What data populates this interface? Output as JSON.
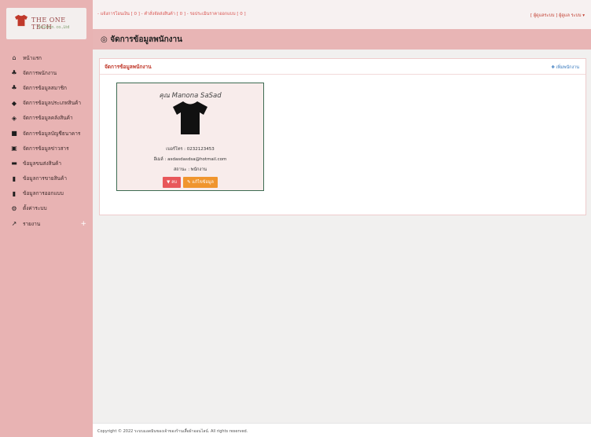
{
  "brand": {
    "title": "THE ONE TECH",
    "subtitle": "Solution. co.,Ltd"
  },
  "sidebar": {
    "items": [
      {
        "label": "หน้าแรก",
        "icon": "home-icon",
        "glyph": "⌂"
      },
      {
        "label": "จัดการพนักงาน",
        "icon": "users-icon",
        "glyph": "♣"
      },
      {
        "label": "จัดการข้อมูลสมาชิก",
        "icon": "members-icon",
        "glyph": "♣"
      },
      {
        "label": "จัดการข้อมูลประเภทสินค้า",
        "icon": "cube-icon",
        "glyph": "◆"
      },
      {
        "label": "จัดการข้อมูลคลังสินค้า",
        "icon": "cubes-icon",
        "glyph": "◈"
      },
      {
        "label": "จัดการข้อมูลบัญชีธนาคาร",
        "icon": "book-icon",
        "glyph": "■"
      },
      {
        "label": "จัดการข้อมูลข่าวสาร",
        "icon": "newspaper-icon",
        "glyph": "▣"
      },
      {
        "label": "ข้อมูลขนส่งสินค้า",
        "icon": "truck-icon",
        "glyph": "▬"
      },
      {
        "label": "ข้อมูลการขายสินค้า",
        "icon": "file-icon",
        "glyph": "▮"
      },
      {
        "label": "ข้อมูลการออกแบบ",
        "icon": "design-file-icon",
        "glyph": "▮"
      },
      {
        "label": "ตั้งค่าระบบ",
        "icon": "gear-icon",
        "glyph": "⚙"
      },
      {
        "label": "รายงาน",
        "icon": "chart-icon",
        "glyph": "↗"
      }
    ]
  },
  "topbar": {
    "links": "- แจ้งการโอนเงิน [ 0 ] - คำสั่งจัดส่งสินค้า [ 0 ] - รอประเมินราคาออกแบบ [ 0 ]",
    "user": "[ ผู้ดูแลระบบ ] ผู้ดูแล ระบบ ▾"
  },
  "header": {
    "icon": "◎",
    "title": "จัดการข้อมูลพนักงาน"
  },
  "panel": {
    "title": "จัดการข้อมูลพนักงาน",
    "add_label": "✚ เพิ่มพนักงาน"
  },
  "employee": {
    "name": "คุณ Manona SaSad",
    "phone": "เบอร์โทร : 0232123453",
    "email": "อีเมล์ : asdasdasdsa@hotmail.com",
    "status": "สถานะ : พนักงาน",
    "delete_label": "ลบ",
    "edit_label": "แก้ไขข้อมูล"
  },
  "footer": {
    "text": "Copyright © 2022 ระบบแอดมินของเจ้าของร้านเสื้อผ้าออนไลน์. All rights reserved."
  },
  "colors": {
    "sidebar": "#e8b3b3",
    "accent": "#c0392b",
    "delete": "#e8575a",
    "edit": "#f0952e",
    "card_border": "#3e6b52"
  }
}
